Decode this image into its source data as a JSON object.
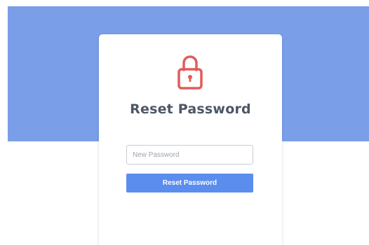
{
  "colors": {
    "hero_band": "#7a9fe8",
    "lock_icon": "#e25b5b",
    "title_text": "#4c5766",
    "button": "#5b8def"
  },
  "card": {
    "icon": "lock-icon",
    "title": "Reset Password",
    "new_password": {
      "placeholder": "New Password",
      "value": ""
    },
    "submit_label": "Reset Password"
  }
}
